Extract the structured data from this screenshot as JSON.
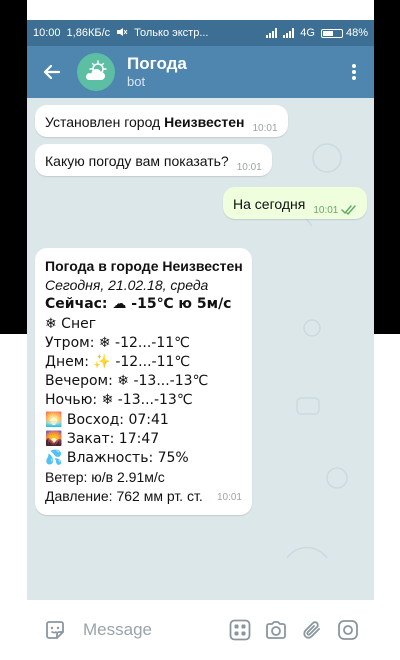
{
  "statusbar": {
    "time": "10:00",
    "speed": "1,86КБ/с",
    "sim": "Только экстр...",
    "network": "4G",
    "battery": "48%"
  },
  "header": {
    "title": "Погода",
    "subtitle": "bot"
  },
  "messages": [
    {
      "text_before": "Установлен город ",
      "text_bold": "Неизвестен",
      "time": "10:01"
    },
    {
      "text": "Какую погоду вам показать?",
      "time": "10:01"
    },
    {
      "text": "На сегодня",
      "time": "10:01"
    }
  ],
  "weather": {
    "title": "Погода в городе Неизвестен",
    "date": "Сегодня, 21.02.18, среда",
    "now": "Сейчас: ☁ -15℃ ю 5м/с",
    "condition": "❄ Снег",
    "morning": "Утром: ❄ -12...-11℃",
    "day": "Днем: ✨ -12...-11℃",
    "evening": "Вечером: ❄ -13...-13℃",
    "night": "Ночью: ❄ -13...-13℃",
    "sunrise": "🌅 Восход: 07:41",
    "sunset": "🌄 Закат: 17:47",
    "humidity": "💦 Влажность: 75%",
    "wind": "Ветер: ю/в 2.91м/с",
    "pressure": "Давление: 762 мм рт. ст.",
    "time": "10:01"
  },
  "input": {
    "placeholder": "Message"
  },
  "colors": {
    "statusbar": "#3c6f93",
    "appbar": "#4f86b0",
    "chat_bg": "#dce7ea",
    "outgoing": "#effedd",
    "avatar": "#5cbfa4"
  }
}
